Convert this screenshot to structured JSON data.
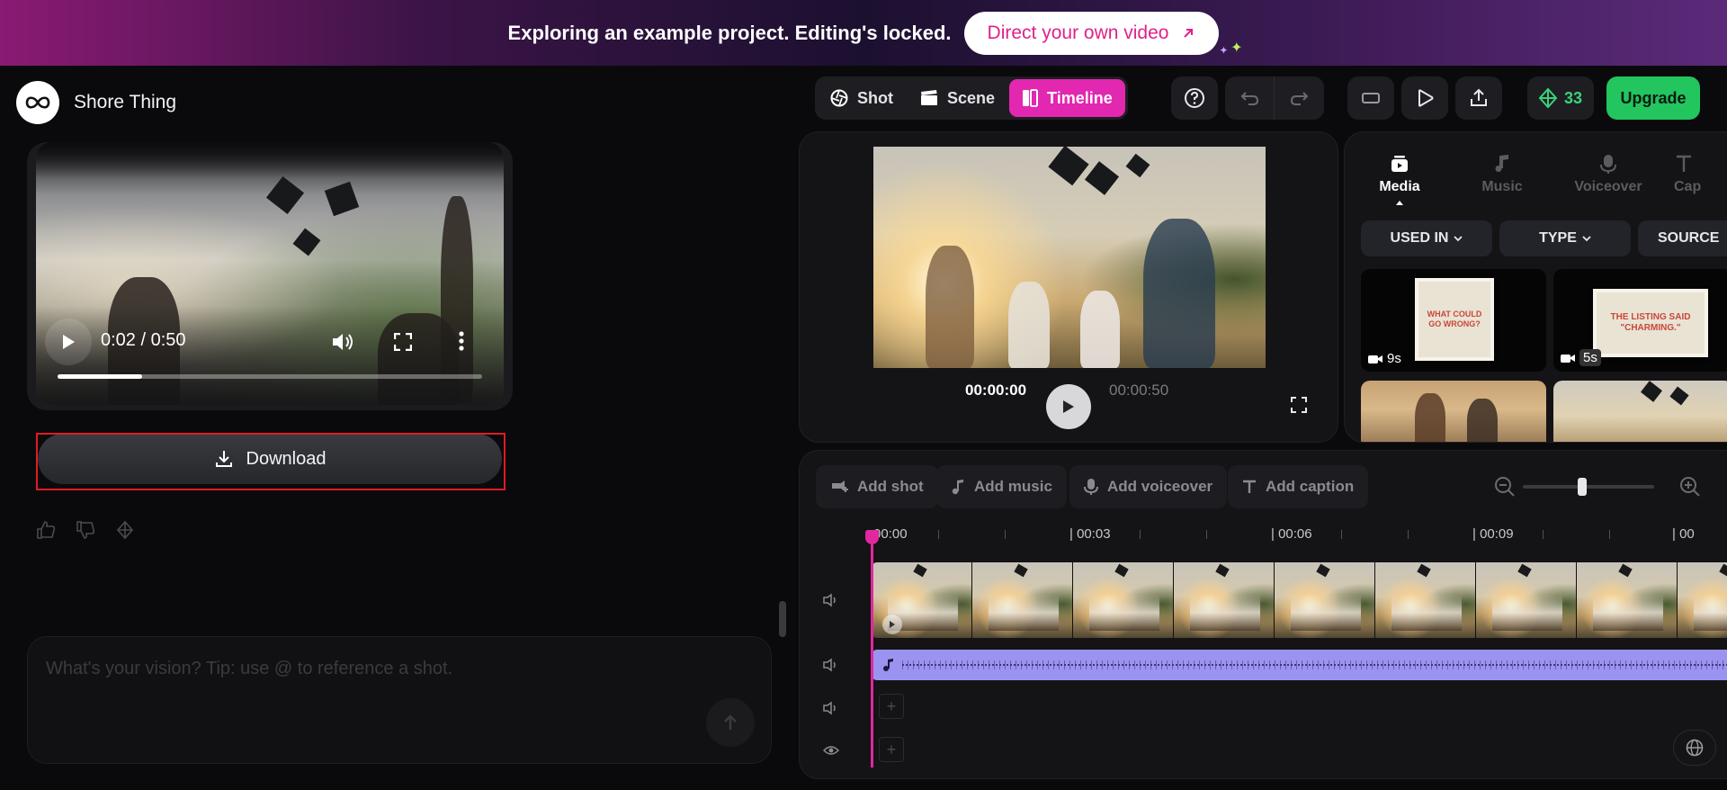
{
  "banner": {
    "message": "Exploring an example project. Editing's locked.",
    "cta_label": "Direct your own video"
  },
  "brand": {
    "name": "Shore Thing"
  },
  "left_video": {
    "time": "0:02 / 0:50",
    "progress": 0.2
  },
  "download": {
    "label": "Download"
  },
  "prompt": {
    "placeholder": "What's your vision? Tip: use @ to reference a shot."
  },
  "view_tabs": [
    {
      "label": "Shot",
      "icon": "aperture-icon",
      "active": false
    },
    {
      "label": "Scene",
      "icon": "clapperboard-icon",
      "active": false
    },
    {
      "label": "Timeline",
      "icon": "timeline-icon",
      "active": true
    }
  ],
  "credits": {
    "count": "33"
  },
  "upgrade": {
    "label": "Upgrade"
  },
  "preview": {
    "current_time": "00:00:00",
    "total_time": "00:00:50"
  },
  "media_panel": {
    "tabs": [
      "Media",
      "Music",
      "Voiceover",
      "Cap"
    ],
    "filters": [
      "USED IN",
      "TYPE",
      "SOURCE"
    ],
    "items": [
      {
        "card_text": "WHAT COULD GO WRONG?",
        "duration": "9s"
      },
      {
        "card_text": "THE LISTING SAID \"CHARMING.\"",
        "duration": "5s"
      }
    ]
  },
  "timeline": {
    "actions": [
      "Add shot",
      "Add music",
      "Add voiceover",
      "Add caption"
    ],
    "ruler": [
      "00:00",
      "| 00:03",
      "| 00:06",
      "| 00:09",
      "| 00"
    ],
    "zoom_level": 0.45
  },
  "colors": {
    "accent": "#e227b0",
    "upgrade": "#22c55e",
    "audio": "#9b93f0",
    "highlight": "#e01b24"
  }
}
